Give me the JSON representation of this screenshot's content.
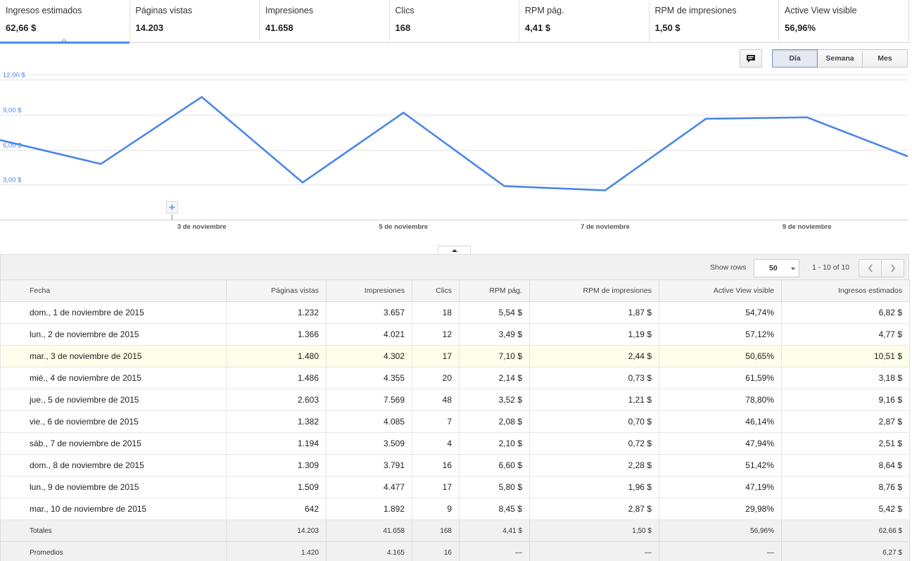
{
  "metrics": [
    {
      "label": "Ingresos estimados",
      "value": "62,66 $"
    },
    {
      "label": "Páginas vistas",
      "value": "14.203"
    },
    {
      "label": "Impresiones",
      "value": "41.658"
    },
    {
      "label": "Clics",
      "value": "168"
    },
    {
      "label": "RPM pág.",
      "value": "4,41 $"
    },
    {
      "label": "RPM de impresiones",
      "value": "1,50 $"
    },
    {
      "label": "Active View visible",
      "value": "56,96%"
    }
  ],
  "toolbar": {
    "comment_icon": "comment-icon",
    "ranges": [
      "Día",
      "Semana",
      "Mes"
    ],
    "selected_range": "Día"
  },
  "chart_data": {
    "type": "line",
    "x": [
      "1 nov",
      "2 nov",
      "3 nov",
      "4 nov",
      "5 nov",
      "6 nov",
      "7 nov",
      "8 nov",
      "9 nov",
      "10 nov"
    ],
    "x_tick_labels": [
      {
        "x": "3 nov",
        "label": "3 de noviembre"
      },
      {
        "x": "5 nov",
        "label": "5 de noviembre"
      },
      {
        "x": "7 nov",
        "label": "7 de noviembre"
      },
      {
        "x": "9 nov",
        "label": "9 de noviembre"
      }
    ],
    "series": [
      {
        "values": [
          6.82,
          4.77,
          10.51,
          3.18,
          9.16,
          2.87,
          2.51,
          8.64,
          8.76,
          5.42
        ],
        "color": "#4a86e8"
      }
    ],
    "ylim": [
      0,
      12
    ],
    "y_ticks": [
      {
        "value": 3,
        "label": "3,00 $"
      },
      {
        "value": 6,
        "label": "6,00 $"
      },
      {
        "value": 9,
        "label": "9,00 $"
      },
      {
        "value": 12,
        "label": "12,00 $"
      }
    ],
    "grid": true,
    "annotation_marker": "plus-icon",
    "annotation_at": "2 nov"
  },
  "table_toolbar": {
    "show_rows_label": "Show rows",
    "rows_value": "50",
    "page_info": "1 - 10 of 10"
  },
  "table": {
    "columns": [
      "Fecha",
      "Páginas vistas",
      "Impresiones",
      "Clics",
      "RPM pág.",
      "RPM de impresiones",
      "Active View visible",
      "Ingresos estimados"
    ],
    "rows": [
      [
        "dom., 1 de noviembre de 2015",
        "1.232",
        "3.657",
        "18",
        "5,54 $",
        "1,87 $",
        "54,74%",
        "6,82 $"
      ],
      [
        "lun., 2 de noviembre de 2015",
        "1.366",
        "4.021",
        "12",
        "3,49 $",
        "1,19 $",
        "57,12%",
        "4,77 $"
      ],
      [
        "mar., 3 de noviembre de 2015",
        "1.480",
        "4.302",
        "17",
        "7,10 $",
        "2,44 $",
        "50,65%",
        "10,51 $"
      ],
      [
        "mié., 4 de noviembre de 2015",
        "1.486",
        "4.355",
        "20",
        "2,14 $",
        "0,73 $",
        "61,59%",
        "3,18 $"
      ],
      [
        "jue., 5 de noviembre de 2015",
        "2.603",
        "7.569",
        "48",
        "3,52 $",
        "1,21 $",
        "78,80%",
        "9,16 $"
      ],
      [
        "vie., 6 de noviembre de 2015",
        "1.382",
        "4.085",
        "7",
        "2,08 $",
        "0,70 $",
        "46,14%",
        "2,87 $"
      ],
      [
        "sáb., 7 de noviembre de 2015",
        "1.194",
        "3.509",
        "4",
        "2,10 $",
        "0,72 $",
        "47,94%",
        "2,51 $"
      ],
      [
        "dom., 8 de noviembre de 2015",
        "1.309",
        "3.791",
        "16",
        "6,60 $",
        "2,28 $",
        "51,42%",
        "8,64 $"
      ],
      [
        "lun., 9 de noviembre de 2015",
        "1.509",
        "4.477",
        "17",
        "5,80 $",
        "1,96 $",
        "47,19%",
        "8,76 $"
      ],
      [
        "mar., 10 de noviembre de 2015",
        "642",
        "1.892",
        "9",
        "8,45 $",
        "2,87 $",
        "29,98%",
        "5,42 $"
      ]
    ],
    "highlighted_row": 2,
    "totals": [
      "Totales",
      "14.203",
      "41.658",
      "168",
      "4,41 $",
      "1,50 $",
      "56,96%",
      "62,66 $"
    ],
    "averages": [
      "Promedios",
      "1.420",
      "4.165",
      "16",
      "—",
      "—",
      "—",
      "6,27 $"
    ]
  },
  "colors": {
    "accent": "#4a8af4",
    "line": "#4a86e8",
    "axis_text": "#4a86e8",
    "highlight_row": "#fdfde9"
  }
}
